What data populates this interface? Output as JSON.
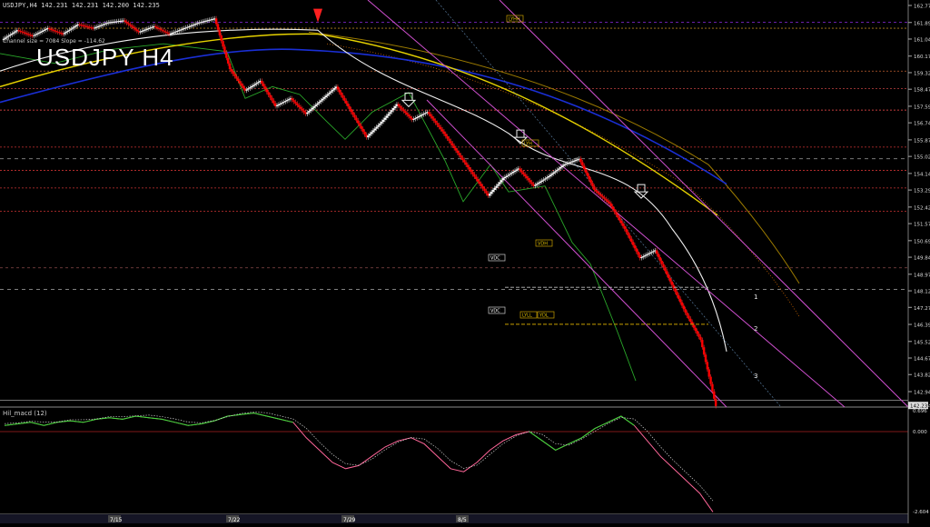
{
  "header": {
    "line": "USDJPY,H4  142.231 142.231 142.200 142.235"
  },
  "watermark": "USDJPY H4",
  "channel_text": "Channel size = 7084 Slope = -114.62",
  "indicator": {
    "label": "Hil_macd (12)",
    "ticks": [
      "0.696",
      "0.000",
      "-2.604"
    ]
  },
  "price_marker": "142.235",
  "colors": {
    "bg": "#000000",
    "up_candle": "#ffffff",
    "down_candle": "#ff0000",
    "channel": "#d050d0",
    "ma_yellow": "#e6d200",
    "ma_blue": "#1a2fd6",
    "ma_white": "#f0f0f0",
    "ichimoku": "#9b7a00",
    "macd_up": "#33dd33",
    "macd_down": "#ff6699"
  },
  "chart_data": {
    "type": "line",
    "symbol": "USDJPY",
    "timeframe": "H4",
    "y_ticks": [
      162.77,
      161.895,
      161.045,
      160.17,
      159.32,
      158.47,
      157.595,
      156.745,
      155.87,
      155.02,
      154.145,
      153.295,
      152.42,
      151.57,
      150.695,
      149.845,
      148.97,
      148.12,
      147.27,
      146.395,
      145.52,
      144.67,
      143.82,
      142.945,
      142.245
    ],
    "x_labels": [
      "7/15",
      "7/22",
      "7/29",
      "8/5"
    ],
    "close_path": [
      161.0,
      161.5,
      161.2,
      161.6,
      161.3,
      161.8,
      161.6,
      161.9,
      162.0,
      161.4,
      161.7,
      161.3,
      161.6,
      161.9,
      162.1,
      159.5,
      158.4,
      158.9,
      157.6,
      158.0,
      157.2,
      157.9,
      158.6,
      157.3,
      156.0,
      156.8,
      157.7,
      156.9,
      157.3,
      156.3,
      155.2,
      154.1,
      153.0,
      153.9,
      154.4,
      153.5,
      154.0,
      154.6,
      154.9,
      153.3,
      152.6,
      151.3,
      149.8,
      150.2,
      148.6,
      147.0,
      145.6,
      142.2
    ],
    "boxes": [
      {
        "label": "VDH"
      },
      {
        "label": "VDC"
      },
      {
        "label": "LYLL"
      },
      {
        "label": "YDL"
      },
      {
        "label": "VDC"
      },
      {
        "label": "LYHH"
      },
      {
        "label": "LYH"
      }
    ],
    "channel_labels": [
      "1",
      "2",
      "3"
    ]
  }
}
